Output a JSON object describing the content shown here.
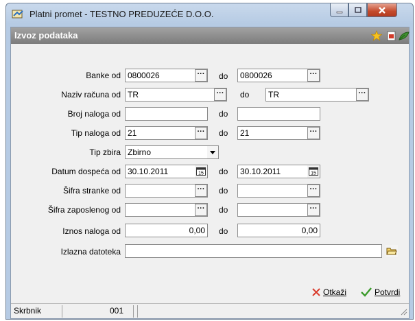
{
  "window": {
    "title": "Platni promet - TESTNO PREDUZEĆE D.O.O."
  },
  "header": {
    "title": "Izvoz podataka",
    "icons": [
      "star-icon",
      "export-icon",
      "plant-icon"
    ]
  },
  "form": {
    "do_label": "do",
    "banke": {
      "label": "Banke od",
      "from": "0800026",
      "to": "0800026"
    },
    "naziv_racuna": {
      "label": "Naziv računa od",
      "from": "TR",
      "to": "TR"
    },
    "broj_naloga": {
      "label": "Broj naloga od",
      "from": "",
      "to": ""
    },
    "tip_naloga": {
      "label": "Tip naloga od",
      "from": "21",
      "to": "21"
    },
    "tip_zbira": {
      "label": "Tip zbira",
      "value": "Zbirno"
    },
    "datum_dospeca": {
      "label": "Datum dospeća od",
      "from": "30.10.2011",
      "to": "30.10.2011"
    },
    "sifra_stranke": {
      "label": "Šifra stranke od",
      "from": "",
      "to": ""
    },
    "sifra_zaposlenog": {
      "label": "Šifra zaposlenog od",
      "from": "",
      "to": ""
    },
    "iznos_naloga": {
      "label": "Iznos naloga od",
      "from": "0,00",
      "to": "0,00"
    },
    "izlazna_datoteka": {
      "label": "Izlazna datoteka",
      "value": ""
    },
    "dots_glyph": "···"
  },
  "actions": {
    "cancel_label": "Otkaži",
    "confirm_label": "Potvrdi"
  },
  "statusbar": {
    "user": "Skrbnik",
    "code": "001"
  },
  "colors": {
    "header_gray": "#8a8a8a",
    "close_red": "#c44a2c",
    "cancel_red": "#d93a2b",
    "confirm_green": "#3a9a2a"
  }
}
